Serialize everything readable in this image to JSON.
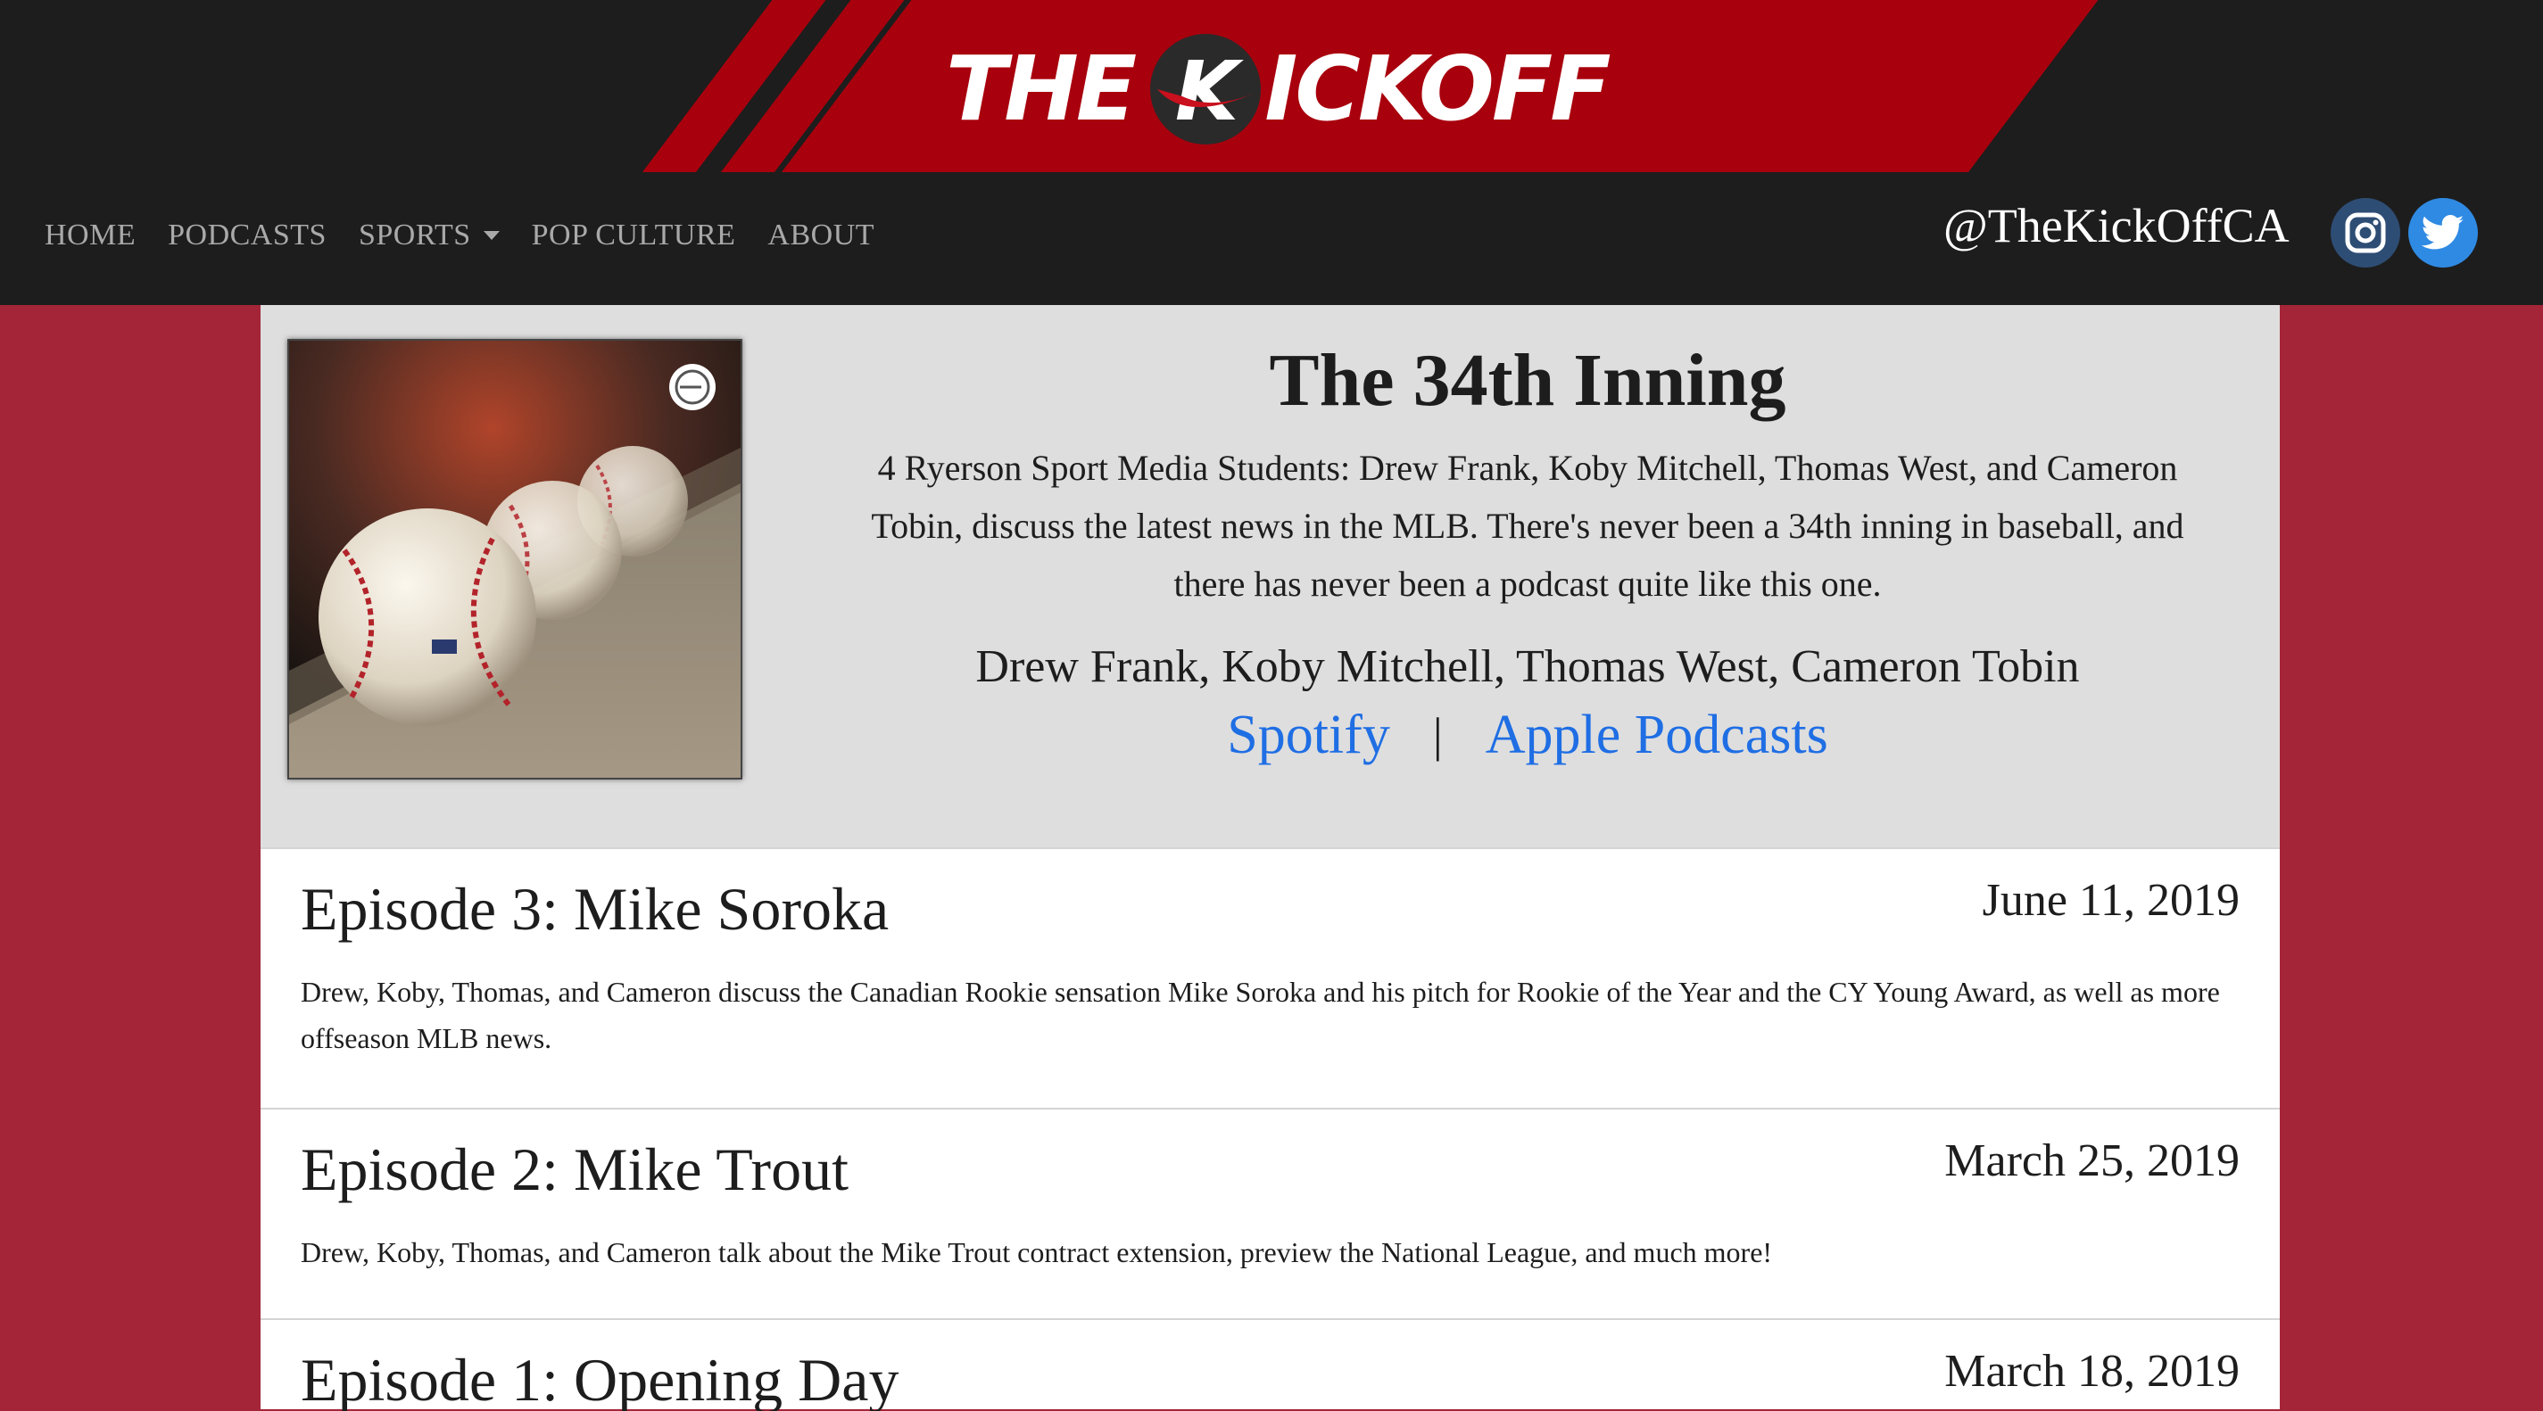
{
  "brand": {
    "logo_text_left": "THE",
    "logo_text_right": "ICKOFF",
    "logo_ball_letter": "K",
    "primary_color": "#a8000d",
    "background_color": "#a42538",
    "header_color": "#1d1d1d"
  },
  "nav": {
    "items": [
      {
        "label": "HOME"
      },
      {
        "label": "PODCASTS"
      },
      {
        "label": "SPORTS"
      },
      {
        "label": "POP CULTURE"
      },
      {
        "label": "ABOUT"
      }
    ],
    "dropdown_icon": "caret-down-icon"
  },
  "social": {
    "handle": "@TheKickOffCA",
    "instagram_icon": "instagram-icon",
    "twitter_icon": "twitter-icon",
    "instagram_color": "#2e4d74",
    "twitter_color": "#2f8ae3"
  },
  "podcast": {
    "title": "The 34th Inning",
    "description": "4 Ryerson Sport Media Students: Drew Frank, Koby Mitchell, Thomas West, and Cameron Tobin, discuss the latest news in the MLB. There's never been a 34th inning in baseball, and there has never been a podcast quite like this one.",
    "hosts": "Drew Frank, Koby Mitchell, Thomas West, Cameron Tobin",
    "links": {
      "spotify": "Spotify",
      "separator": "|",
      "apple": "Apple Podcasts"
    },
    "link_color": "#1f6ee4",
    "cover_badge_icon": "anchor-podcast-icon"
  },
  "episodes": [
    {
      "title": "Episode 3: Mike Soroka",
      "date": "June 11, 2019",
      "description": "Drew, Koby, Thomas, and Cameron discuss the Canadian Rookie sensation Mike Soroka and his pitch for Rookie of the Year and the CY Young Award, as well as more offseason MLB news."
    },
    {
      "title": "Episode 2: Mike Trout",
      "date": "March 25, 2019",
      "description": "Drew, Koby, Thomas, and Cameron talk about the Mike Trout contract extension, preview the National League, and much more!"
    },
    {
      "title": "Episode 1: Opening Day",
      "date": "March 18, 2019",
      "description": ""
    }
  ]
}
